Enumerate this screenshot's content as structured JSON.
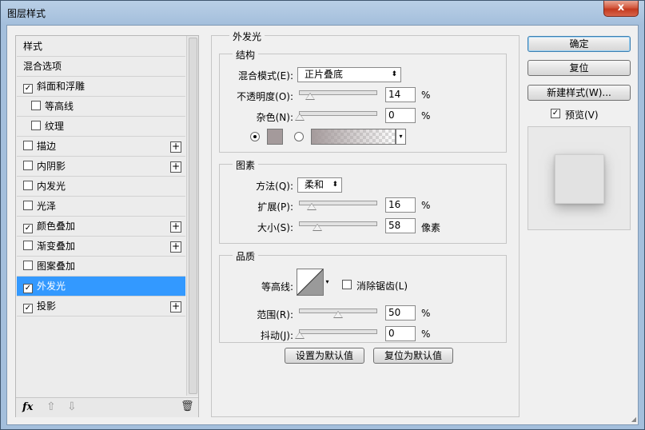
{
  "window": {
    "title": "图层样式",
    "close_glyph": "x"
  },
  "styles_list": {
    "items": [
      {
        "label": "样式",
        "checkbox": false,
        "checked": false,
        "indent": false,
        "plus": false,
        "selected": false
      },
      {
        "label": "混合选项",
        "checkbox": false,
        "checked": false,
        "indent": false,
        "plus": false,
        "selected": false
      },
      {
        "label": "斜面和浮雕",
        "checkbox": true,
        "checked": true,
        "indent": false,
        "plus": false,
        "selected": false
      },
      {
        "label": "等高线",
        "checkbox": true,
        "checked": false,
        "indent": true,
        "plus": false,
        "selected": false
      },
      {
        "label": "纹理",
        "checkbox": true,
        "checked": false,
        "indent": true,
        "plus": false,
        "selected": false
      },
      {
        "label": "描边",
        "checkbox": true,
        "checked": false,
        "indent": false,
        "plus": true,
        "selected": false
      },
      {
        "label": "内阴影",
        "checkbox": true,
        "checked": false,
        "indent": false,
        "plus": true,
        "selected": false
      },
      {
        "label": "内发光",
        "checkbox": true,
        "checked": false,
        "indent": false,
        "plus": false,
        "selected": false
      },
      {
        "label": "光泽",
        "checkbox": true,
        "checked": false,
        "indent": false,
        "plus": false,
        "selected": false
      },
      {
        "label": "颜色叠加",
        "checkbox": true,
        "checked": true,
        "indent": false,
        "plus": true,
        "selected": false
      },
      {
        "label": "渐变叠加",
        "checkbox": true,
        "checked": false,
        "indent": false,
        "plus": true,
        "selected": false
      },
      {
        "label": "图案叠加",
        "checkbox": true,
        "checked": false,
        "indent": false,
        "plus": false,
        "selected": false
      },
      {
        "label": "外发光",
        "checkbox": true,
        "checked": true,
        "indent": false,
        "plus": false,
        "selected": true
      },
      {
        "label": "投影",
        "checkbox": true,
        "checked": true,
        "indent": false,
        "plus": true,
        "selected": false
      }
    ],
    "footer": {
      "fx_label": "fx",
      "up_glyph": "⇧",
      "down_glyph": "⇩",
      "trash_glyph": "🗑"
    }
  },
  "outer_glow": {
    "title": "外发光",
    "structure": {
      "title": "结构",
      "blend_mode_label": "混合模式(E):",
      "blend_mode_value": "正片叠底",
      "opacity_label": "不透明度(O):",
      "opacity_value": "14",
      "opacity_fraction": 0.14,
      "noise_label": "杂色(N):",
      "noise_value": "0",
      "noise_fraction": 0,
      "percent": "%",
      "color": "#a49a9b",
      "color_mode": "solid"
    },
    "elements": {
      "title": "图素",
      "technique_label": "方法(Q):",
      "technique_value": "柔和",
      "spread_label": "扩展(P):",
      "spread_value": "16",
      "spread_fraction": 0.16,
      "size_label": "大小(S):",
      "size_value": "58",
      "size_fraction": 0.233,
      "percent": "%",
      "px_unit": "像素"
    },
    "quality": {
      "title": "品质",
      "contour_label": "等高线:",
      "antialias_label": "消除锯齿(L)",
      "antialias_checked": false,
      "range_label": "范围(R):",
      "range_value": "50",
      "range_fraction": 0.5,
      "jitter_label": "抖动(J):",
      "jitter_value": "0",
      "jitter_fraction": 0,
      "percent": "%"
    },
    "make_default_label": "设置为默认值",
    "reset_default_label": "复位为默认值"
  },
  "actions": {
    "ok_label": "确定",
    "reset_label": "复位",
    "new_style_label": "新建样式(W)...",
    "preview_label": "预览(V)",
    "preview_checked": true
  },
  "glyphs": {
    "check": "✓",
    "plus": "+",
    "select_arrow": "⬍",
    "drop_arrow": "▾"
  }
}
